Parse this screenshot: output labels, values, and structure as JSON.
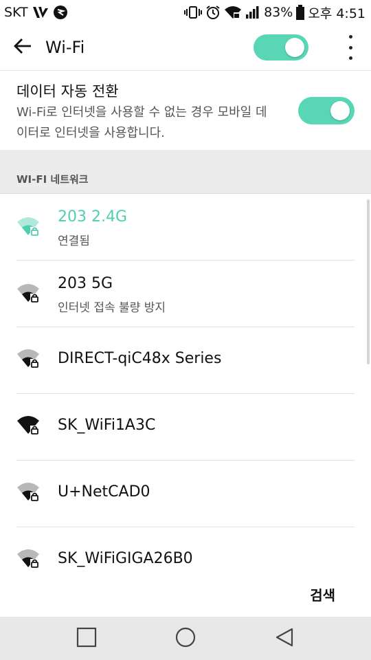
{
  "status_bar": {
    "carrier": "SKT",
    "battery_percent": "83%",
    "time": "오후 4:51",
    "icons": [
      "carrier-logo-icon",
      "app-notification-icon",
      "vibrate-icon",
      "alarm-icon",
      "wifi-signal-icon",
      "cellular-signal-icon",
      "battery-icon"
    ]
  },
  "app_bar": {
    "title": "Wi-Fi",
    "wifi_enabled": true,
    "icons": [
      "back-arrow-icon",
      "overflow-menu-icon"
    ]
  },
  "auto_switch": {
    "title": "데이터 자동 전환",
    "description": "Wi-Fi로 인터넷을 사용할 수 없는 경우 모바일 데이터로 인터넷을 사용합니다.",
    "enabled": true
  },
  "section": {
    "label": "WI-FI 네트워크"
  },
  "networks": [
    {
      "ssid": "203 2.4G",
      "status": "연결됨",
      "connected": true,
      "secured": true
    },
    {
      "ssid": "203 5G",
      "status": "인터넷 접속 불량 방지",
      "connected": false,
      "secured": true
    },
    {
      "ssid": "DIRECT-qiC48x Series",
      "status": "",
      "connected": false,
      "secured": true
    },
    {
      "ssid": "SK_WiFi1A3C",
      "status": "",
      "connected": false,
      "secured": true
    },
    {
      "ssid": "U+NetCAD0",
      "status": "",
      "connected": false,
      "secured": true
    },
    {
      "ssid": "SK_WiFiGIGA26B0",
      "status": "",
      "connected": false,
      "secured": true
    }
  ],
  "footer": {
    "search_label": "검색"
  },
  "nav_bar": {
    "icons": [
      "recents-square-icon",
      "home-circle-icon",
      "back-triangle-icon"
    ]
  },
  "colors": {
    "accent": "#58d6b5",
    "connected_text": "#4fcfb0",
    "section_bg": "#ececec",
    "nav_bg": "#e8e8e8"
  }
}
